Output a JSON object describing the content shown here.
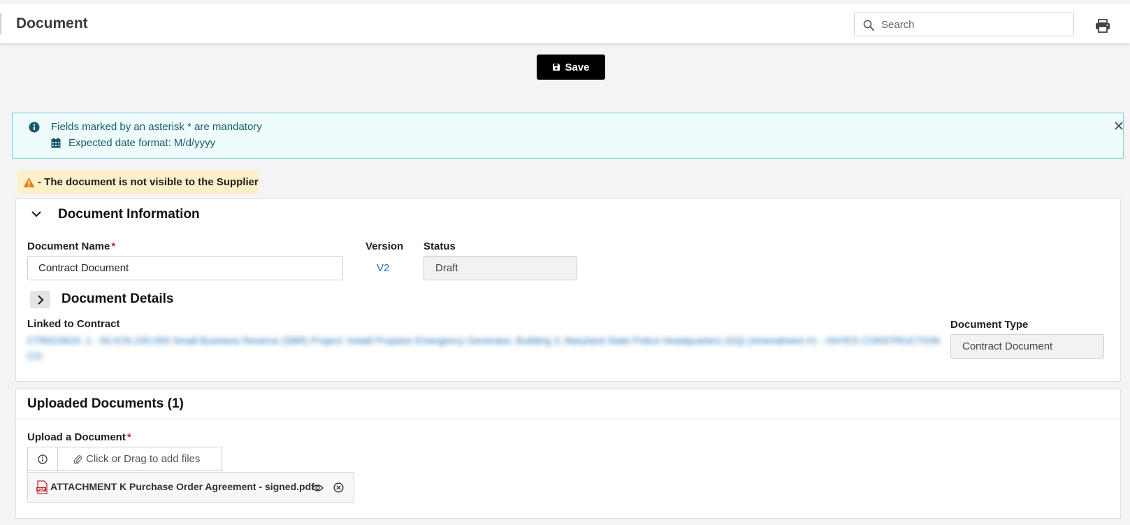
{
  "header": {
    "title": "Document",
    "search_placeholder": "Search",
    "search_value": ""
  },
  "toolbar": {
    "save_label": "Save"
  },
  "info_banner": {
    "mandatory_text": "Fields marked by an asterisk * are mandatory",
    "date_format_text": "Expected date format: M/d/yyyy"
  },
  "warning": {
    "text": "- The document is not visible to the Supplier"
  },
  "document_information": {
    "section_title": "Document Information",
    "document_name_label": "Document Name",
    "required_mark": "*",
    "document_name_value": "Contract Document",
    "version_label": "Version",
    "version_value": "V2",
    "status_label": "Status",
    "status_value": "Draft",
    "details_title": "Document Details",
    "linked_contract_label": "Linked to Contract",
    "linked_contract_value": "CTR023919 -1 - 50-ICN-230-005 Small Business Reserve (SBR) Project: Install Propane Emergency Generator, Building 3, Maryland State Police Headquarters (SQ) (Amendment #1 - HAYES CONSTRUCTION CO",
    "document_type_label": "Document Type",
    "document_type_value": "Contract Document"
  },
  "uploaded_documents": {
    "section_title": "Uploaded Documents (1)",
    "upload_label": "Upload a Document",
    "required_mark": "*",
    "dropzone_text": "Click or Drag to add files",
    "files": [
      {
        "name": "ATTACHMENT K Purchase Order Agreement - signed.pdf"
      }
    ]
  },
  "colors": {
    "accent_link": "#1a6fb4",
    "save_button": "#000000",
    "info_banner_bg": "#eefcfc",
    "info_banner_border": "#7fcfd0",
    "warning_bg": "#fdefc8",
    "warning_icon": "#e67e22",
    "required": "#c0282d"
  },
  "icons": {
    "search": "search-icon",
    "print": "printer-icon",
    "save": "floppy-disk-icon",
    "info": "info-circle-icon",
    "calendar": "calendar-icon",
    "close": "close-icon",
    "warning": "warning-triangle-icon",
    "collapse": "chevron-down-icon",
    "expand": "chevron-right-icon",
    "attach": "paperclip-icon",
    "pdf": "pdf-file-icon",
    "view": "eye-icon",
    "remove": "remove-circle-icon"
  }
}
